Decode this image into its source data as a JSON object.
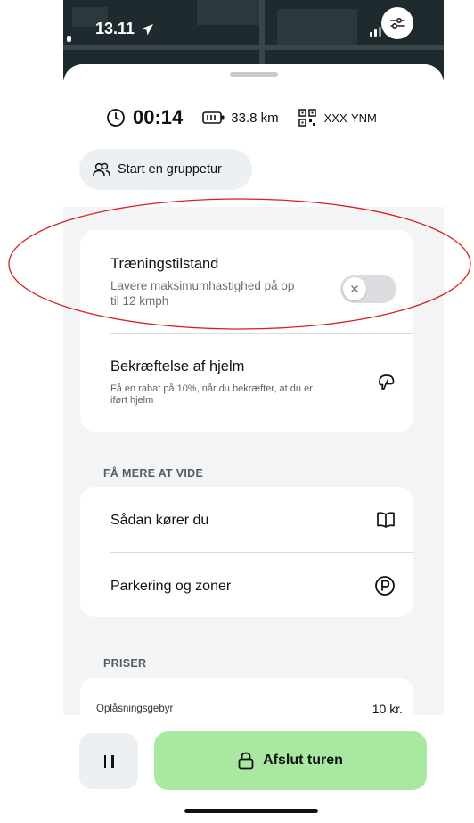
{
  "status_bar": {
    "time": "13.11"
  },
  "trip_stats": {
    "duration": "00:14",
    "range": "33.8 km",
    "plate": "XXX-YNM"
  },
  "group_ride": {
    "label": "Start en gruppetur"
  },
  "training_mode": {
    "title": "Træningstilstand",
    "subtitle_line1": "Lavere maksimumhastighed på op",
    "subtitle_line2": "til 12 kmph",
    "enabled": false
  },
  "helmet": {
    "title": "Bekræftelse af hjelm",
    "subtitle_line1": "Få en rabat på 10%, når du bekræfter, at du er",
    "subtitle_line2": "iført hjelm"
  },
  "learn_more": {
    "header": "FÅ MERE AT VIDE",
    "items": [
      {
        "label": "Sådan kører du",
        "icon": "book-icon"
      },
      {
        "label": "Parkering og zoner",
        "icon": "parking-icon"
      }
    ]
  },
  "prices": {
    "header": "PRISER",
    "rows": [
      {
        "label": "Oplåsningsgebyr",
        "value": "10 kr."
      }
    ]
  },
  "actions": {
    "end_ride_label": "Afslut turen"
  },
  "colors": {
    "end_button_bg": "#a8e8a0",
    "annotation": "#d62020"
  }
}
